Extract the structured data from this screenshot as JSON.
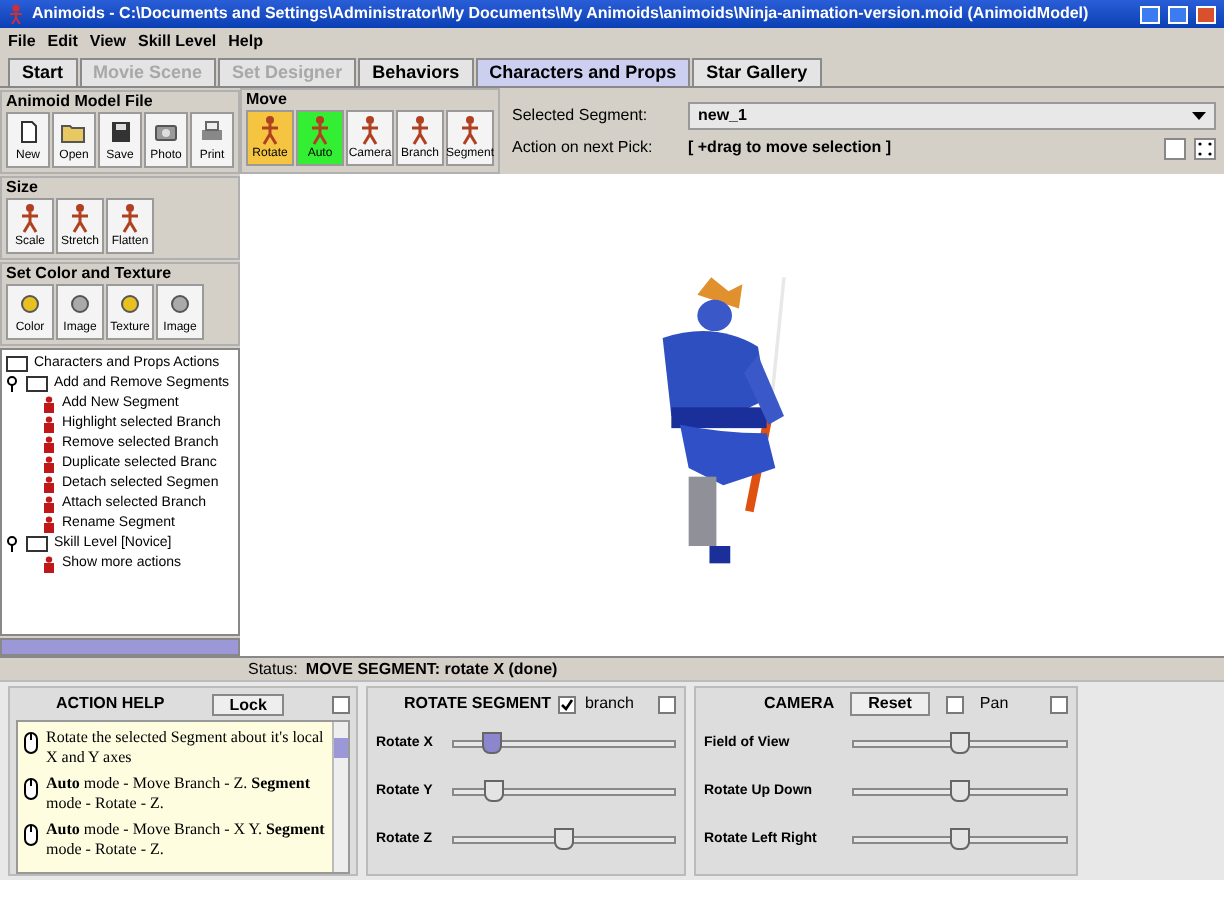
{
  "window": {
    "title": "Animoids - C:\\Documents and Settings\\Administrator\\My Documents\\My Animoids\\animoids\\Ninja-animation-version.moid (AnimoidModel)"
  },
  "menu": [
    "File",
    "Edit",
    "View",
    "Skill Level",
    "Help"
  ],
  "tabs": [
    {
      "label": "Start",
      "selected": false,
      "disabled": false
    },
    {
      "label": "Movie Scene",
      "selected": false,
      "disabled": true
    },
    {
      "label": "Set Designer",
      "selected": false,
      "disabled": true
    },
    {
      "label": "Behaviors",
      "selected": false,
      "disabled": false
    },
    {
      "label": "Characters and Props",
      "selected": true,
      "disabled": false
    },
    {
      "label": "Star Gallery",
      "selected": false,
      "disabled": false
    }
  ],
  "file_group": {
    "title": "Animoid Model File",
    "buttons": [
      {
        "label": "New",
        "kind": "page"
      },
      {
        "label": "Open",
        "kind": "folder"
      },
      {
        "label": "Save",
        "kind": "disk"
      },
      {
        "label": "Photo",
        "kind": "camera"
      },
      {
        "label": "Print",
        "kind": "printer"
      }
    ]
  },
  "move_group": {
    "title": "Move",
    "buttons": [
      {
        "label": "Rotate",
        "color": "#f5c542"
      },
      {
        "label": "Auto",
        "color": "#33ee33"
      },
      {
        "label": "Camera",
        "color": "#f4f4f4"
      },
      {
        "label": "Branch",
        "color": "#f4f4f4"
      },
      {
        "label": "Segment",
        "color": "#f4f4f4"
      }
    ]
  },
  "size_group": {
    "title": "Size",
    "buttons": [
      "Scale",
      "Stretch",
      "Flatten"
    ]
  },
  "color_group": {
    "title": "Set Color and Texture",
    "buttons": [
      "Color",
      "Image",
      "Texture",
      "Image"
    ]
  },
  "selection": {
    "segment_label": "Selected Segment:",
    "segment_value": "new_1",
    "action_label": "Action on next Pick:",
    "action_value": "[ +drag to move selection ]"
  },
  "tree": {
    "label": "Characters and Props Actions",
    "children": [
      {
        "label": "Add and Remove Segments",
        "kind": "folder",
        "expanded": true,
        "children": [
          {
            "label": "Add New Segment",
            "kind": "action"
          },
          {
            "label": "Highlight selected Branch",
            "kind": "action"
          },
          {
            "label": "Remove selected Branch",
            "kind": "action"
          },
          {
            "label": "Duplicate selected Branc",
            "kind": "action"
          },
          {
            "label": "Detach selected Segmen",
            "kind": "action"
          },
          {
            "label": "Attach selected Branch",
            "kind": "action"
          },
          {
            "label": "Rename Segment",
            "kind": "action"
          }
        ]
      },
      {
        "label": "Skill Level [Novice]",
        "kind": "folder",
        "expanded": true,
        "children": [
          {
            "label": "Show more actions",
            "kind": "action"
          }
        ]
      }
    ]
  },
  "status": {
    "label": "Status:",
    "value": "MOVE SEGMENT: rotate X (done)"
  },
  "action_help": {
    "title": "ACTION HELP",
    "lock": "Lock",
    "corner_checkbox": {
      "checked": false
    },
    "items": [
      "Rotate the selected Segment about it's local X and Y axes",
      "**Auto** mode - Move Branch - Z. **Segment** mode - Rotate - Z.",
      "**Auto** mode - Move Branch - X Y. **Segment** mode - Rotate - Z."
    ]
  },
  "rotate_segment": {
    "title": "ROTATE SEGMENT",
    "branch": {
      "label": "branch",
      "checked": true
    },
    "corner_checkbox": {
      "checked": false
    },
    "sliders": [
      {
        "label": "Rotate X",
        "level": 0.17,
        "active": true
      },
      {
        "label": "Rotate Y",
        "level": 0.18,
        "active": false
      },
      {
        "label": "Rotate Z",
        "level": 0.5,
        "active": false
      }
    ]
  },
  "camera": {
    "title": "CAMERA",
    "reset": "Reset",
    "pan": {
      "label": "Pan",
      "checked": false
    },
    "corner_checkbox": {
      "checked": false
    },
    "sliders": [
      {
        "label": "Field of View",
        "level": 0.5
      },
      {
        "label": "Rotate Up Down",
        "level": 0.5
      },
      {
        "label": "Rotate Left Right",
        "level": 0.5
      }
    ]
  }
}
